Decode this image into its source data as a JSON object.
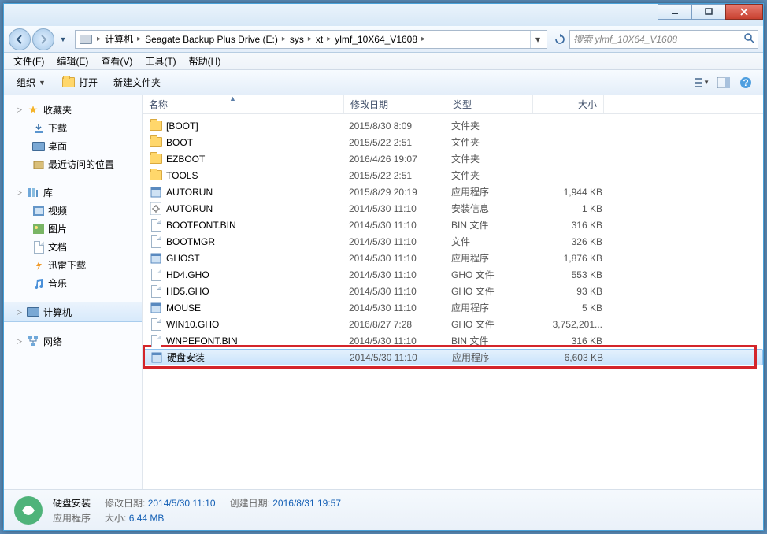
{
  "titlebar": {},
  "nav": {
    "breadcrumb": [
      "计算机",
      "Seagate Backup Plus Drive (E:)",
      "sys",
      "xt",
      "ylmf_10X64_V1608"
    ],
    "search_placeholder": "搜索 ylmf_10X64_V1608"
  },
  "menus": [
    "文件(F)",
    "编辑(E)",
    "查看(V)",
    "工具(T)",
    "帮助(H)"
  ],
  "toolbar": {
    "organize": "组织",
    "open": "打开",
    "newfolder": "新建文件夹"
  },
  "sidebar": {
    "fav": {
      "label": "收藏夹",
      "items": [
        "下载",
        "桌面",
        "最近访问的位置"
      ]
    },
    "lib": {
      "label": "库",
      "items": [
        "视频",
        "图片",
        "文档",
        "迅雷下载",
        "音乐"
      ]
    },
    "computer": "计算机",
    "network": "网络"
  },
  "columns": {
    "name": "名称",
    "date": "修改日期",
    "type": "类型",
    "size": "大小"
  },
  "files": [
    {
      "icon": "folder",
      "name": "[BOOT]",
      "date": "2015/8/30 8:09",
      "type": "文件夹",
      "size": ""
    },
    {
      "icon": "folder",
      "name": "BOOT",
      "date": "2015/5/22 2:51",
      "type": "文件夹",
      "size": ""
    },
    {
      "icon": "folder",
      "name": "EZBOOT",
      "date": "2016/4/26 19:07",
      "type": "文件夹",
      "size": ""
    },
    {
      "icon": "folder",
      "name": "TOOLS",
      "date": "2015/5/22 2:51",
      "type": "文件夹",
      "size": ""
    },
    {
      "icon": "app",
      "name": "AUTORUN",
      "date": "2015/8/29 20:19",
      "type": "应用程序",
      "size": "1,944 KB"
    },
    {
      "icon": "ini",
      "name": "AUTORUN",
      "date": "2014/5/30 11:10",
      "type": "安装信息",
      "size": "1 KB"
    },
    {
      "icon": "file",
      "name": "BOOTFONT.BIN",
      "date": "2014/5/30 11:10",
      "type": "BIN 文件",
      "size": "316 KB"
    },
    {
      "icon": "file",
      "name": "BOOTMGR",
      "date": "2014/5/30 11:10",
      "type": "文件",
      "size": "326 KB"
    },
    {
      "icon": "app",
      "name": "GHOST",
      "date": "2014/5/30 11:10",
      "type": "应用程序",
      "size": "1,876 KB"
    },
    {
      "icon": "file",
      "name": "HD4.GHO",
      "date": "2014/5/30 11:10",
      "type": "GHO 文件",
      "size": "553 KB"
    },
    {
      "icon": "file",
      "name": "HD5.GHO",
      "date": "2014/5/30 11:10",
      "type": "GHO 文件",
      "size": "93 KB"
    },
    {
      "icon": "app",
      "name": "MOUSE",
      "date": "2014/5/30 11:10",
      "type": "应用程序",
      "size": "5 KB"
    },
    {
      "icon": "file",
      "name": "WIN10.GHO",
      "date": "2016/8/27 7:28",
      "type": "GHO 文件",
      "size": "3,752,201..."
    },
    {
      "icon": "file",
      "name": "WNPEFONT.BIN",
      "date": "2014/5/30 11:10",
      "type": "BIN 文件",
      "size": "316 KB"
    },
    {
      "icon": "app-sel",
      "name": "硬盘安装",
      "date": "2014/5/30 11:10",
      "type": "应用程序",
      "size": "6,603 KB",
      "selected": true
    }
  ],
  "details": {
    "name": "硬盘安装",
    "type": "应用程序",
    "mod_label": "修改日期:",
    "mod_value": "2014/5/30 11:10",
    "create_label": "创建日期:",
    "create_value": "2016/8/31 19:57",
    "size_label": "大小:",
    "size_value": "6.44 MB"
  }
}
